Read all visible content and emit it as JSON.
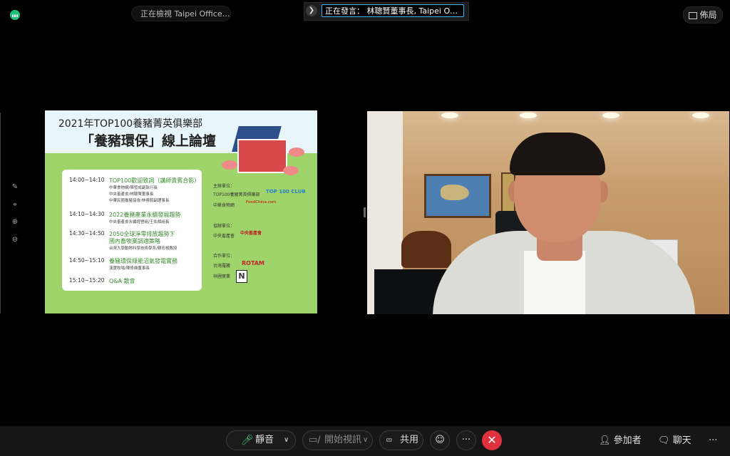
{
  "topbar": {
    "viewing_text": "正在檢視 Taipei Office Fo...",
    "speaking_text": "正在發言： 林聰賢董事長, Taipei Office F...",
    "layout_label": "佈局"
  },
  "slide": {
    "title_line1": "2021年TOP100養豬菁英俱樂部",
    "title_line2": "「養豬環保」線上論壇",
    "schedule": [
      {
        "time": "14:00~14:10",
        "heading": "TOP100歡迎致詞（講師貴賓合影）",
        "lines": [
          "中華食物網/陳發成副執行長",
          "中央畜產會/林聰賢董事長",
          "中華民國養豬協會/林睿毅副理事長"
        ]
      },
      {
        "time": "14:10~14:30",
        "heading": "2022養豬產業永續發展趨勢",
        "lines": [
          "中央畜產會永續經營組/王佑相組長"
        ]
      },
      {
        "time": "14:30~14:50",
        "heading": "2050全球淨零排放趨勢下",
        "heading2": "國內畜牧業調適策略",
        "lines": [
          "台灣大學動物科學技術學系/蘇忠楨教授"
        ]
      },
      {
        "time": "14:50~15:10",
        "heading": "養豬環保綠能沼氣發電實務",
        "lines": [
          "漢寶牧場/陳修雄董事長"
        ]
      },
      {
        "time": "15:10~15:20",
        "heading": "Q&A  散會",
        "lines": []
      }
    ],
    "organizers": {
      "host_label": "主辦單位：",
      "host_org1": "TOP100養豬菁英俱樂部",
      "host_org1_logo": "TOP 100 CLUB",
      "host_org2": "中華食物網",
      "host_org2_logo": "FoodChina.com",
      "co_label": "協辦單位：",
      "co_org": "中央畜產會",
      "co_logo": "中央畜產會",
      "partner_label": "合作單位：",
      "partner_org1": "台灣羅騰",
      "partner_org1_logo": "ROTAM",
      "partner_org2": "祥圃實業",
      "partner_org2_logo": "N"
    }
  },
  "toolbar": {
    "mute_label": "靜音",
    "video_label": "開始視訊",
    "share_label": "共用",
    "more_label": "···",
    "participants_label": "參加者",
    "chat_label": "聊天",
    "overflow_label": "···"
  },
  "colors": {
    "end_call": "#e0323e",
    "speaking_border": "#3bb3ff",
    "slide_green": "#9fd46a"
  }
}
